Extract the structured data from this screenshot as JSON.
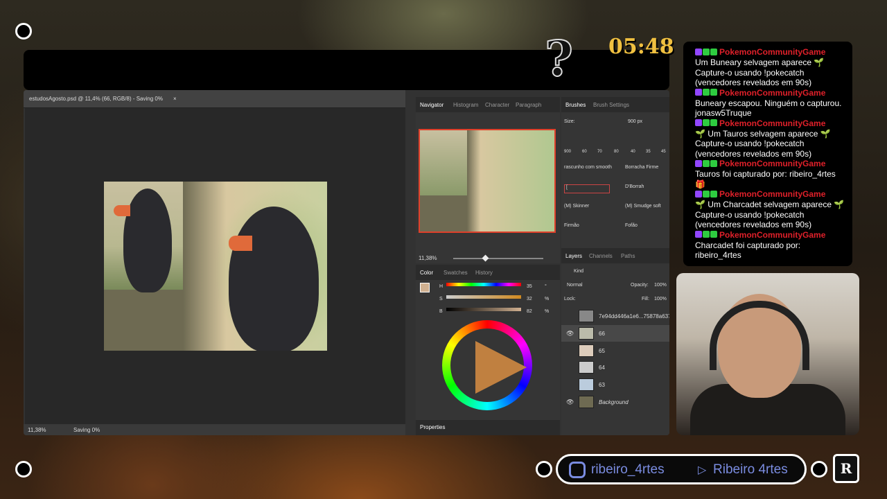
{
  "stream": {
    "timer": "05:48",
    "question_mark": "?"
  },
  "photoshop": {
    "doc_tab": "estudosAgosto.psd @ 11,4% (66, RGB/8) - Saving 0%",
    "close_glyph": "×",
    "status_zoom": "11,38%",
    "status_text": "Saving 0%",
    "navigator": {
      "tabs": [
        "Navigator",
        "Histogram",
        "Character",
        "Paragraph"
      ],
      "zoom": "11,38%"
    },
    "color_panel": {
      "tabs": [
        "Color",
        "Swatches",
        "History"
      ],
      "h_label": "H",
      "h_value": "35",
      "h_unit": "°",
      "s_label": "S",
      "s_value": "32",
      "s_unit": "%",
      "b_label": "B",
      "b_value": "82",
      "b_unit": "%"
    },
    "properties_tab": "Properties",
    "brushes": {
      "tabs": [
        "Brushes",
        "Brush Settings"
      ],
      "size_label": "Size:",
      "size_value": "900 px",
      "presets": [
        "900",
        "60",
        "70",
        "80",
        "40",
        "35",
        "45"
      ],
      "names": [
        "rascunho com smooth",
        "Borracha Firme",
        "[",
        "D'Borrah",
        "(M) Skinner",
        "(M) Smudge soft",
        "Firmão",
        "Fofão"
      ]
    },
    "layers": {
      "tabs": [
        "Layers",
        "Channels",
        "Paths"
      ],
      "kind": "Kind",
      "blend": "Normal",
      "opacity_label": "Opacity:",
      "opacity": "100%",
      "lock_label": "Lock:",
      "fill_label": "Fill:",
      "fill": "100%",
      "items": [
        "7e94dd446a1e6...75878a637ed0",
        "66",
        "65",
        "64",
        "63",
        "Background"
      ]
    }
  },
  "chat": [
    {
      "user": "PokemonCommunityGame",
      "text": "Um Buneary selvagem aparece 🌱 Capture-o usando !pokecatch (vencedores revelados em 90s)"
    },
    {
      "user": "PokemonCommunityGame",
      "text": "Buneary escapou. Ninguém o capturou. jonasw5Truque"
    },
    {
      "user": "PokemonCommunityGame",
      "text": "🌱 Um Tauros selvagem aparece 🌱 Capture-o usando !pokecatch (vencedores revelados em 90s)"
    },
    {
      "user": "PokemonCommunityGame",
      "text": "Tauros foi capturado por: ribeiro_4rtes 🎁"
    },
    {
      "user": "PokemonCommunityGame",
      "text": "🌱 Um Charcadet selvagem aparece 🌱 Capture-o usando !pokecatch (vencedores revelados em 90s)"
    },
    {
      "user": "PokemonCommunityGame",
      "text": "Charcadet foi capturado por: ribeiro_4rtes"
    }
  ],
  "social": {
    "instagram": "ribeiro_4rtes",
    "youtube": "Ribeiro 4rtes",
    "logo": "R"
  }
}
